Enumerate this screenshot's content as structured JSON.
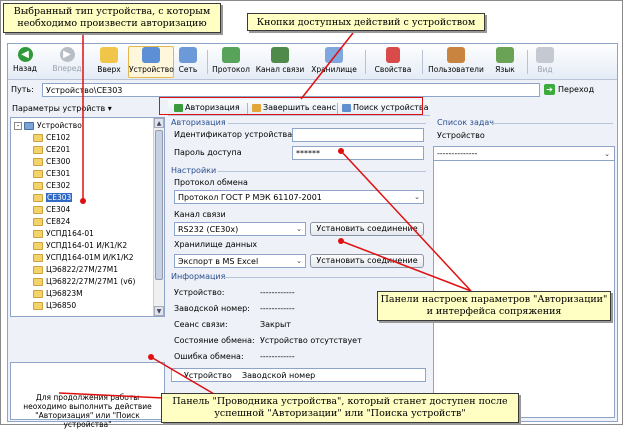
{
  "toolbar": {
    "back": "Назад",
    "forward": "Вперед",
    "up": "Вверх",
    "device": "Устройство",
    "network": "Сеть",
    "protocol": "Протокол",
    "channel": "Канал связи",
    "storage": "Хранилище",
    "properties": "Свойства",
    "users": "Пользователи",
    "language": "Язык",
    "view": "Вид"
  },
  "pathbar": {
    "label": "Путь:",
    "value": "Устройство\\CE303",
    "go": "Переход"
  },
  "left": {
    "header": "Параметры устройств",
    "tree_root": "Устройство",
    "tree_items": [
      "CE102",
      "CE201",
      "CE300",
      "CE301",
      "CE302",
      "CE303",
      "CE304",
      "CE824",
      "УСПД164-01",
      "УСПД164-01 И/К1/К2",
      "УСПД164-01М И/К1/К2",
      "ЦЭ6822/27М/27М1",
      "ЦЭ6822/27М/27М1 (v6)",
      "ЦЭ6823М",
      "ЦЭ6850"
    ],
    "selected": "CE303",
    "info": "Для продолжения работы неоходимо выполнить действие \"Авторизация\" или \"Поиск устройства\""
  },
  "actions": {
    "auth": "Авторизация",
    "end": "Завершить сеанс",
    "search": "Поиск устройства"
  },
  "auth": {
    "section": "Авторизация",
    "id_label": "Идентификатор устройства",
    "id_value": "",
    "pwd_label": "Пароль доступа",
    "pwd_value": "******"
  },
  "settings": {
    "section": "Настройки",
    "protocol_label": "Протокол обмена",
    "protocol_value": "Протокол ГОСТ Р МЭК 61107-2001",
    "channel_label": "Канал связи",
    "channel_value": "RS232 (CE30x)",
    "connect1": "Установить соединение",
    "storage_label": "Хранилище данных",
    "storage_value": "Экспорт в MS Excel",
    "connect2": "Установить соединение"
  },
  "info": {
    "section": "Информация",
    "device_label": "Устройство:",
    "device_value": "------------",
    "serial_label": "Заводской номер:",
    "serial_value": "------------",
    "session_label": "Сеанс связи:",
    "session_value": "Закрыт",
    "state_label": "Состояние обмена:",
    "state_value": "Устройство отсутствует",
    "error_label": "Ошибка обмена:",
    "error_value": "------------",
    "col_device": "Устройство",
    "col_serial": "Заводской номер"
  },
  "tasks": {
    "section": "Список задач",
    "device_label": "Устройство",
    "device_value": "--------------"
  },
  "annotations": {
    "device_type": "Выбранный тип устройства, с которым необходимо произвести авторизацию",
    "action_buttons": "Кнопки доступных действий с устройством",
    "panels": "Панели настроек параметров \"Авторизации\" и интерфейса сопряжения",
    "explorer": "Панель \"Проводника устройства\", который станет доступен после успешной \"Авторизации\" или \"Поиска устройств\""
  },
  "colors": {
    "accent": "#e01010",
    "callout": "#ffffc4",
    "selection": "#3169c6",
    "section_title": "#2a4d8f"
  }
}
